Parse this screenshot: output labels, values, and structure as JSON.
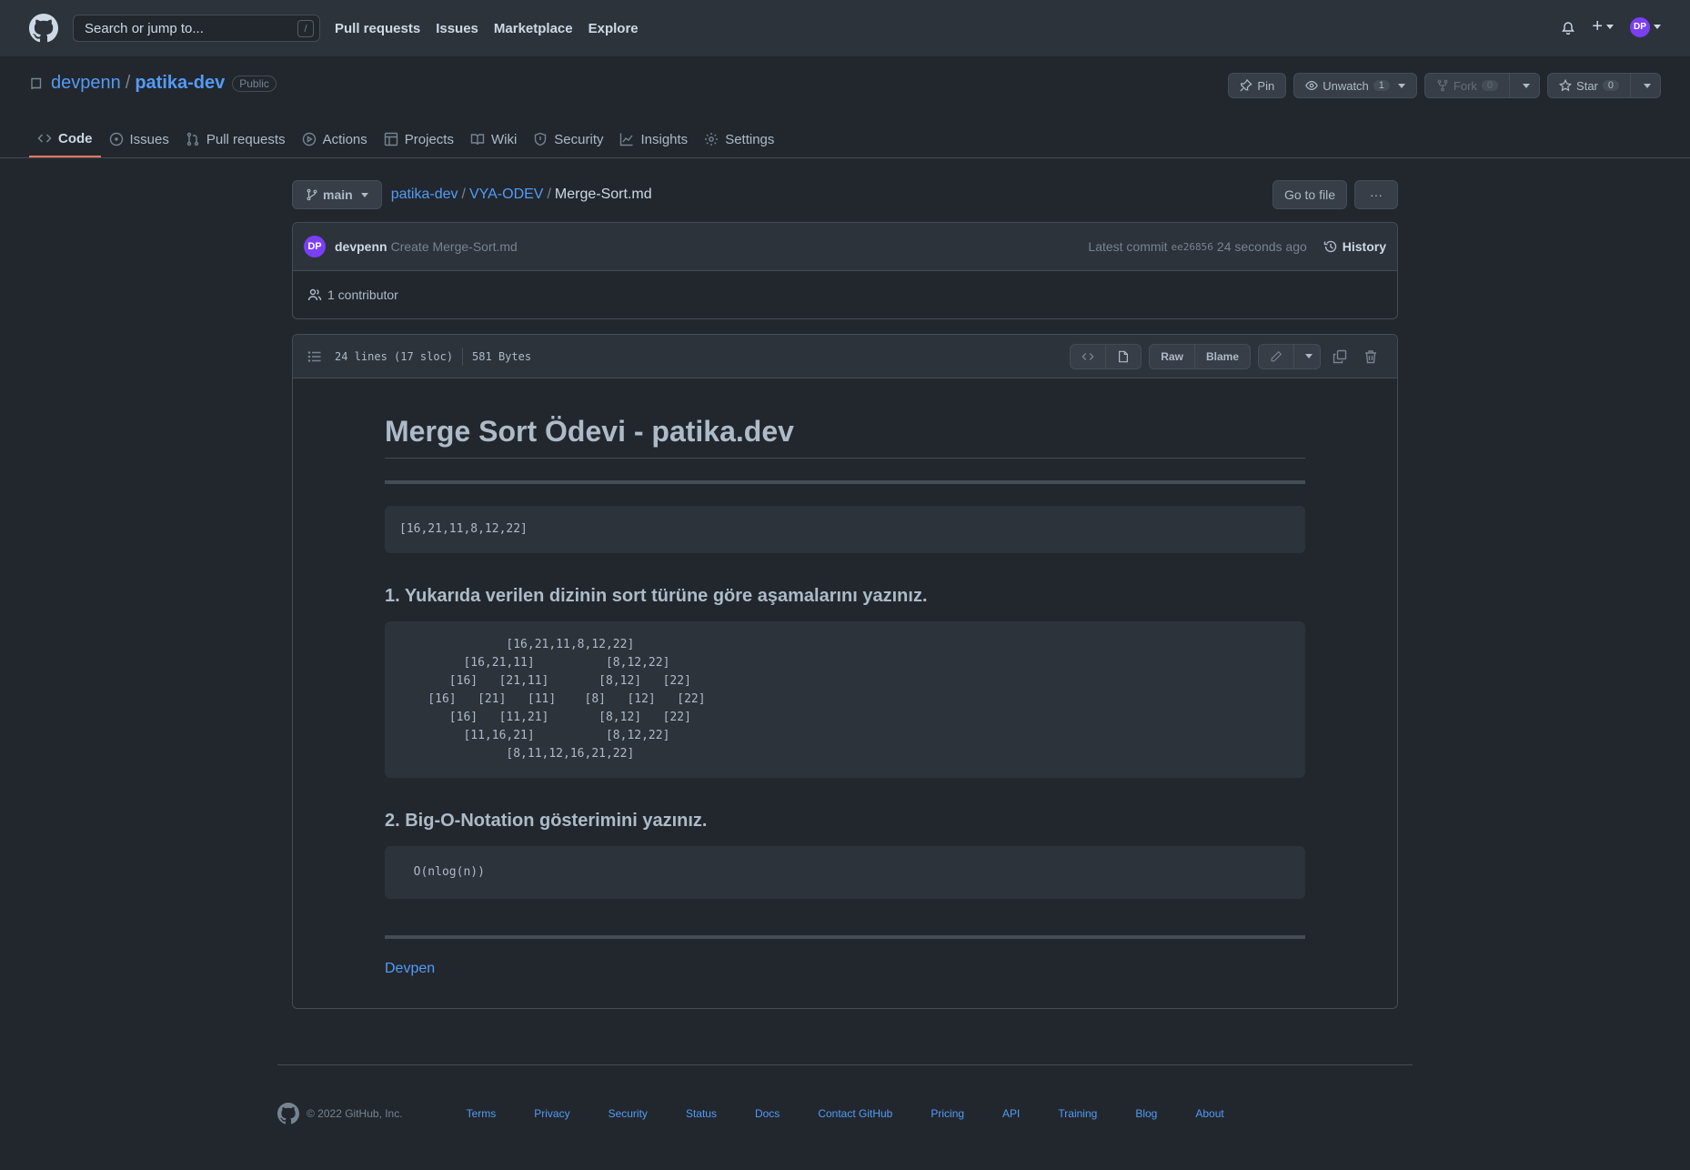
{
  "header": {
    "search_placeholder": "Search or jump to...",
    "search_shortcut": "/",
    "nav": [
      "Pull requests",
      "Issues",
      "Marketplace",
      "Explore"
    ],
    "avatar_initials": "DP",
    "plus_label": "+"
  },
  "repo": {
    "owner": "devpenn",
    "separator": "/",
    "name": "patika-dev",
    "visibility": "Public",
    "pin_label": "Pin",
    "unwatch_label": "Unwatch",
    "watch_count": "1",
    "fork_label": "Fork",
    "fork_count": "0",
    "star_label": "Star",
    "star_count": "0"
  },
  "reponav": [
    {
      "label": "Code",
      "icon": "code-icon",
      "active": true
    },
    {
      "label": "Issues",
      "icon": "issue-icon"
    },
    {
      "label": "Pull requests",
      "icon": "pull-request-icon"
    },
    {
      "label": "Actions",
      "icon": "play-icon"
    },
    {
      "label": "Projects",
      "icon": "table-icon"
    },
    {
      "label": "Wiki",
      "icon": "book-icon"
    },
    {
      "label": "Security",
      "icon": "shield-icon"
    },
    {
      "label": "Insights",
      "icon": "graph-icon"
    },
    {
      "label": "Settings",
      "icon": "gear-icon"
    }
  ],
  "file_nav": {
    "branch": "main",
    "crumb_repo": "patika-dev",
    "crumb_dir": "VYA-ODEV",
    "crumb_file": "Merge-Sort.md",
    "go_to_file": "Go to file",
    "more": "···"
  },
  "commit": {
    "avatar_initials": "DP",
    "author": "devpenn",
    "message": "Create Merge-Sort.md",
    "latest_label": "Latest commit",
    "sha": "ee26856",
    "time": "24 seconds ago",
    "history_label": "History",
    "contributors": "1 contributor"
  },
  "file": {
    "lines": "24 lines (17 sloc)",
    "size": "581 Bytes",
    "raw_label": "Raw",
    "blame_label": "Blame"
  },
  "markdown": {
    "title": "Merge Sort Ödevi - patika.dev",
    "array": "[16,21,11,8,12,22]",
    "q1": "1. Yukarıda verilen dizinin sort türüne göre aşamalarını yazınız.",
    "tree": "               [16,21,11,8,12,22]\n         [16,21,11]          [8,12,22]\n       [16]   [21,11]       [8,12]   [22]\n    [16]   [21]   [11]    [8]   [12]   [22]\n       [16]   [11,21]       [8,12]   [22]\n         [11,16,21]          [8,12,22]\n               [8,11,12,16,21,22]",
    "q2": "2. Big-O-Notation gösterimini yazınız.",
    "bigo": "  O(nlog(n))",
    "signature": "Devpen"
  },
  "footer": {
    "copyright": "© 2022 GitHub, Inc.",
    "links": [
      "Terms",
      "Privacy",
      "Security",
      "Status",
      "Docs",
      "Contact GitHub",
      "Pricing",
      "API",
      "Training",
      "Blog",
      "About"
    ]
  },
  "colors": {
    "background": "#22272e",
    "header": "#2d333b",
    "link": "#539bf5",
    "active_tab": "#ec775c",
    "avatar": "#7b3ff2"
  }
}
